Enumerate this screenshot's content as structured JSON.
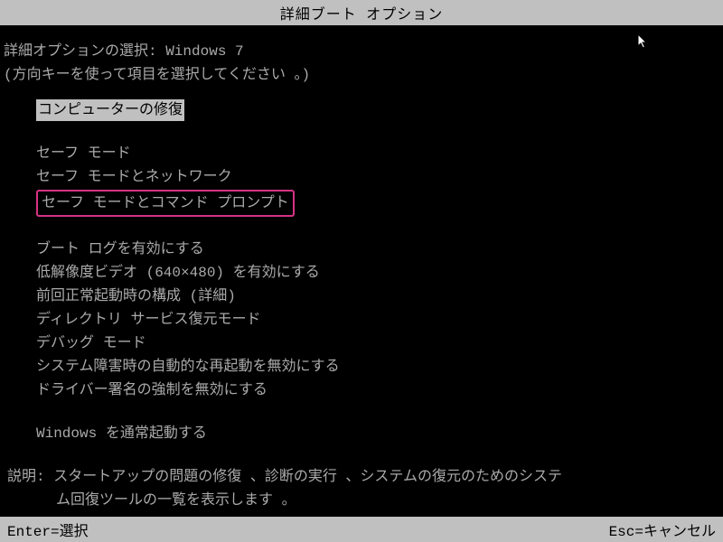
{
  "title": "詳細ブート オプション",
  "header": {
    "prompt": "詳細オプションの選択: Windows 7",
    "instruction": "(方向キーを使って項目を選択してください 。)"
  },
  "menu": {
    "groups": [
      {
        "items": [
          {
            "label": "コンピューターの修復",
            "selected": true,
            "highlighted": false
          }
        ]
      },
      {
        "items": [
          {
            "label": "セーフ モード",
            "selected": false,
            "highlighted": false
          },
          {
            "label": "セーフ モードとネットワーク",
            "selected": false,
            "highlighted": false
          },
          {
            "label": "セーフ モードとコマンド プロンプト",
            "selected": false,
            "highlighted": true
          }
        ]
      },
      {
        "items": [
          {
            "label": "ブート ログを有効にする",
            "selected": false,
            "highlighted": false
          },
          {
            "label": "低解像度ビデオ (640×480) を有効にする",
            "selected": false,
            "highlighted": false
          },
          {
            "label": "前回正常起動時の構成 (詳細)",
            "selected": false,
            "highlighted": false
          },
          {
            "label": "ディレクトリ サービス復元モード",
            "selected": false,
            "highlighted": false
          },
          {
            "label": "デバッグ モード",
            "selected": false,
            "highlighted": false
          },
          {
            "label": "システム障害時の自動的な再起動を無効にする",
            "selected": false,
            "highlighted": false
          },
          {
            "label": "ドライバー署名の強制を無効にする",
            "selected": false,
            "highlighted": false
          }
        ]
      },
      {
        "items": [
          {
            "label": "Windows を通常起動する",
            "selected": false,
            "highlighted": false
          }
        ]
      }
    ]
  },
  "description": {
    "label": "説明: ",
    "line1": "スタートアップの問題の修復 、診断の実行 、システムの復元のためのシステ",
    "line2": "ム回復ツールの一覧を表示します 。"
  },
  "footer": {
    "left": "Enter=選択",
    "right": "Esc=キャンセル"
  }
}
